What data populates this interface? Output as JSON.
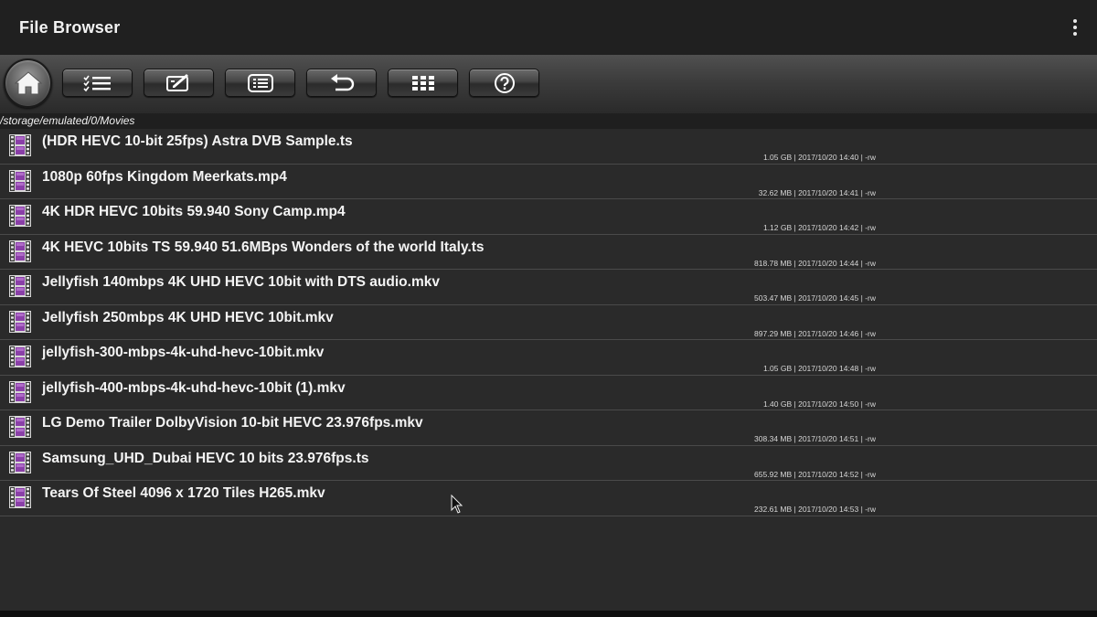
{
  "app": {
    "title": "File Browser"
  },
  "toolbar": {
    "buttons": [
      {
        "icon": "home-icon"
      },
      {
        "icon": "checklist-icon"
      },
      {
        "icon": "edit-icon"
      },
      {
        "icon": "list-icon"
      },
      {
        "icon": "undo-icon"
      },
      {
        "icon": "grid-icon"
      },
      {
        "icon": "help-icon"
      }
    ]
  },
  "path": "/storage/emulated/0/Movies",
  "files": [
    {
      "name": "(HDR HEVC 10-bit 25fps) Astra DVB Sample.ts",
      "meta": "1.05 GB | 2017/10/20 14:40 | -rw"
    },
    {
      "name": "1080p 60fps Kingdom Meerkats.mp4",
      "meta": "32.62 MB | 2017/10/20 14:41 | -rw"
    },
    {
      "name": "4K HDR HEVC 10bits 59.940 Sony Camp.mp4",
      "meta": "1.12 GB | 2017/10/20 14:42 | -rw"
    },
    {
      "name": "4K HEVC 10bits TS 59.940 51.6MBps Wonders of the world Italy.ts",
      "meta": "818.78 MB | 2017/10/20 14:44 | -rw"
    },
    {
      "name": "Jellyfish 140mbps 4K UHD HEVC 10bit with DTS audio.mkv",
      "meta": "503.47 MB | 2017/10/20 14:45 | -rw"
    },
    {
      "name": "Jellyfish 250mbps 4K UHD HEVC 10bit.mkv",
      "meta": "897.29 MB | 2017/10/20 14:46 | -rw"
    },
    {
      "name": "jellyfish-300-mbps-4k-uhd-hevc-10bit.mkv",
      "meta": "1.05 GB | 2017/10/20 14:48 | -rw"
    },
    {
      "name": "jellyfish-400-mbps-4k-uhd-hevc-10bit (1).mkv",
      "meta": "1.40 GB | 2017/10/20 14:50 | -rw"
    },
    {
      "name": "LG Demo  Trailer DolbyVision 10-bit HEVC 23.976fps.mkv",
      "meta": "308.34 MB | 2017/10/20 14:51 | -rw"
    },
    {
      "name": "Samsung_UHD_Dubai HEVC 10 bits 23.976fps.ts",
      "meta": "655.92 MB | 2017/10/20 14:52 | -rw"
    },
    {
      "name": "Tears Of Steel 4096 x 1720 Tiles H265.mkv",
      "meta": "232.61 MB | 2017/10/20 14:53 | -rw"
    }
  ],
  "colors": {
    "background": "#2a2a2a",
    "actionbar": "#202020",
    "file_icon": "#8a3fa8"
  }
}
